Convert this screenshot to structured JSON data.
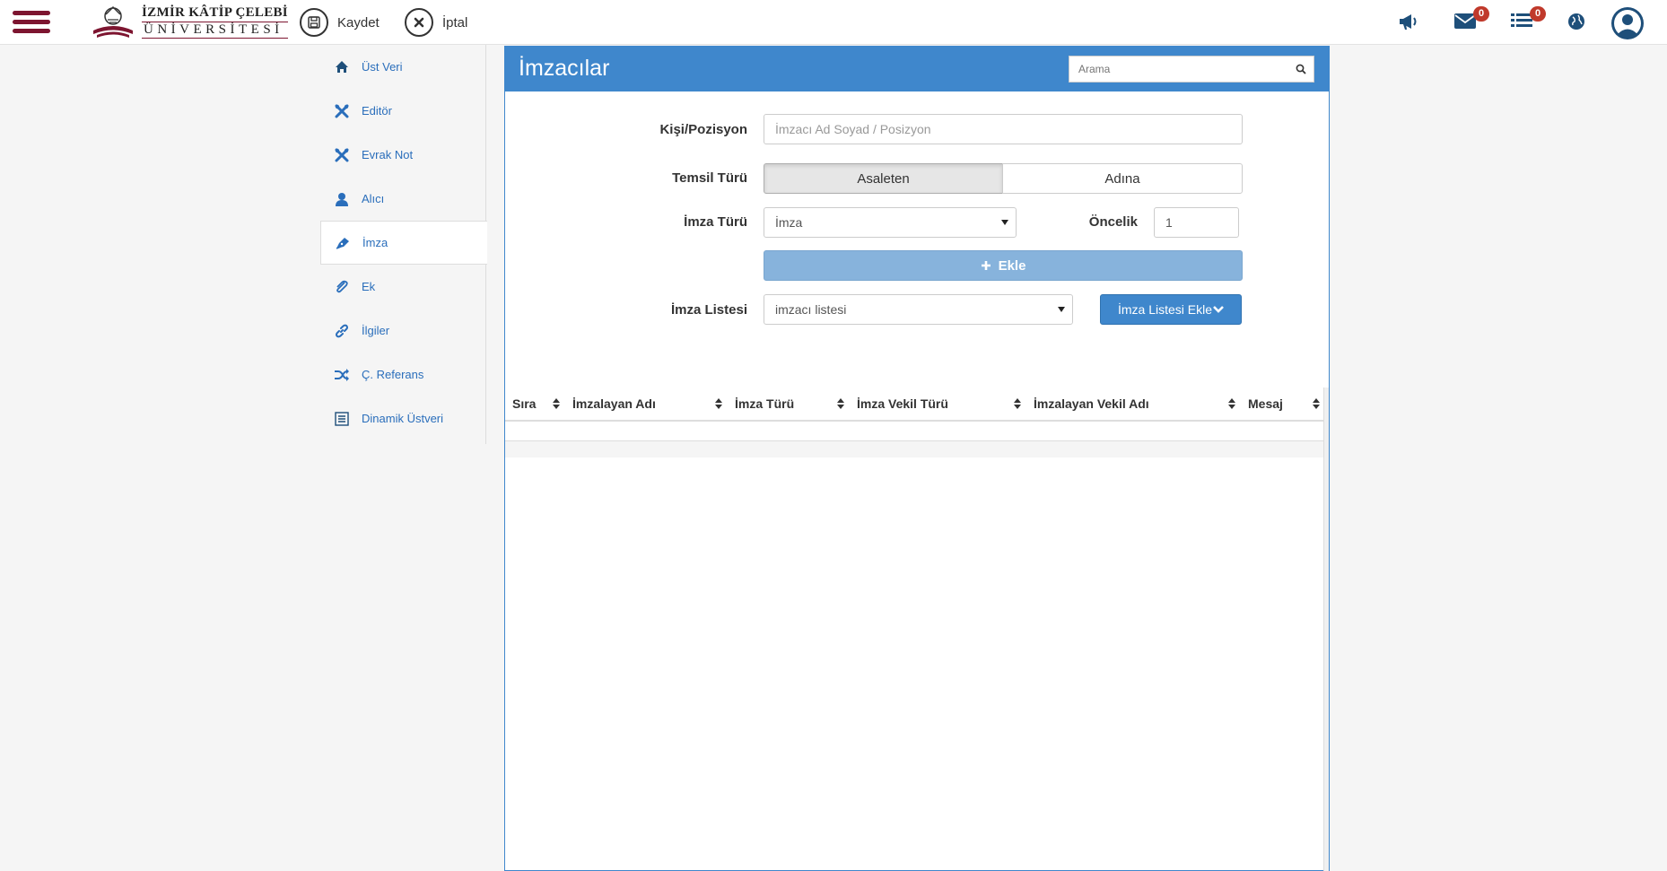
{
  "topbar": {
    "logo_line1": "İZMİR KÂTİP ÇELEBİ",
    "logo_line2": "ÜNİVERSİTESİ",
    "save_label": "Kaydet",
    "cancel_label": "İptal",
    "mail_count": "0",
    "tasks_count": "0"
  },
  "sidebar": {
    "items": [
      {
        "label": "Üst Veri",
        "icon": "home-icon"
      },
      {
        "label": "Editör",
        "icon": "tools-icon"
      },
      {
        "label": "Evrak Not",
        "icon": "tools-icon"
      },
      {
        "label": "Alıcı",
        "icon": "user-icon"
      },
      {
        "label": "İmza",
        "icon": "pen-icon"
      },
      {
        "label": "Ek",
        "icon": "paperclip-icon"
      },
      {
        "label": "İlgiler",
        "icon": "link-icon"
      },
      {
        "label": "Ç. Referans",
        "icon": "shuffle-icon"
      },
      {
        "label": "Dinamik Üstveri",
        "icon": "list-icon"
      }
    ],
    "active_index": 4
  },
  "panel": {
    "title": "İmzacılar",
    "search_placeholder": "Arama",
    "form": {
      "kisi_label": "Kişi/Pozisyon",
      "kisi_placeholder": "İmzacı Ad Soyad / Posizyon",
      "temsil_label": "Temsil Türü",
      "temsil_options": [
        "Asaleten",
        "Adına"
      ],
      "temsil_selected": "Asaleten",
      "imza_turu_label": "İmza Türü",
      "imza_turu_value": "İmza",
      "oncelik_label": "Öncelik",
      "oncelik_value": "1",
      "add_button": "Ekle",
      "imza_listesi_label": "İmza Listesi",
      "imza_listesi_value": "imzacı listesi",
      "imza_listesi_button": "İmza Listesi Ekle"
    },
    "table": {
      "columns": [
        "Sıra",
        "İmzalayan Adı",
        "İmza Türü",
        "İmza Vekil Türü",
        "İmzalayan Vekil Adı",
        "Mesaj"
      ],
      "rows": []
    }
  }
}
